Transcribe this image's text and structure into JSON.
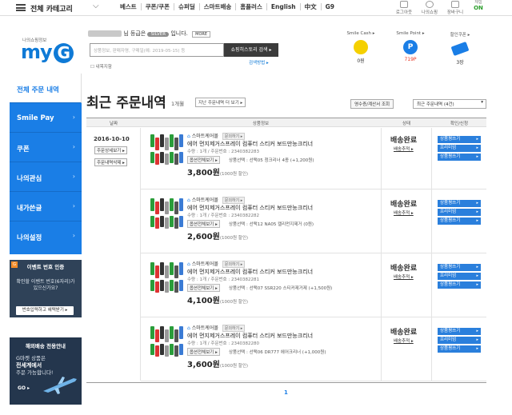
{
  "topbar": {
    "all_category": "전체 카테고리",
    "nav": [
      "베스트",
      "쿠폰/쿠폰",
      "슈퍼딜",
      "스마트배송",
      "홈플러스",
      "English",
      "中文",
      "G9"
    ],
    "icons": [
      {
        "name": "login-icon",
        "label": "로그아웃"
      },
      {
        "name": "mypage-icon",
        "label": "나의쇼핑"
      },
      {
        "name": "cart-icon",
        "label": "장바구니"
      }
    ],
    "toggle": {
      "label": "체험",
      "value": "ON"
    }
  },
  "header": {
    "brand_small": "나의쇼핑정보",
    "brand": "my",
    "brand_g": "G",
    "grade_prefix": "님 등급은",
    "grade": "SILVER",
    "grade_suffix": "입니다.",
    "grade_more": "MORE",
    "search_placeholder": "상품정보, 판매자명, 구매일(예: 2019-05-15) 등",
    "search_button": "쇼핑히스토리 검색 ▸",
    "search_help": "검색방법 ▸",
    "checkbox_label": "☐ 내목지함",
    "smile_cash": {
      "label": "Smile Cash ▸",
      "value": "0원"
    },
    "smile_point": {
      "label": "Smile Point ▸",
      "value": "719P"
    },
    "coupon": {
      "label": "할인쿠폰 ▸",
      "value": "3장"
    },
    "colors": {
      "brand": "#0f7ad6",
      "smile_cash": "#f5d000",
      "smile_point": "#1a7ee6"
    }
  },
  "sidebar": {
    "items": [
      {
        "label": "전체 주문 내역",
        "active": true
      },
      {
        "label": "Smile Pay",
        "active": false
      },
      {
        "label": "쿠폰",
        "active": false
      },
      {
        "label": "나의관심",
        "active": false
      },
      {
        "label": "내가쓴글",
        "active": false
      },
      {
        "label": "나의설정",
        "active": false
      }
    ],
    "event": {
      "badge": "G",
      "title": "이벤트 번호 인증",
      "text": "확인할 이벤트 번호(6자리)가 있으신가요?",
      "button": "번호입력하고 혜택받기 ▸"
    },
    "shipping": {
      "title": "해외배송 전용안내",
      "text1": "G마켓 상품은",
      "text2": "전세계에서",
      "text3": "주문 가능합니다!",
      "go": "GO ▸"
    }
  },
  "main": {
    "title": "최근 주문내역",
    "count": "1개월",
    "more_btn": "지난 주문내역 더 보기 ▸",
    "receipt_btn": "영수증/계산서 조회",
    "period": "최근 주문내역 (4건)",
    "columns": [
      "날짜",
      "상품정보",
      "상태",
      "확인/신청"
    ],
    "order_date": "2016-10-10",
    "order_detail_btn": "주문상세보기 ▸",
    "order_delete_btn": "주문내역삭제 ▸",
    "pagination": "1",
    "rows": [
      {
        "seller": "스마트케어몰",
        "seller_tag": "문의하기 ▸",
        "name": "에어 먼지제거스프레이 컴퓨터 스티커 보드만능크리너",
        "qty": "수량 : 1개 / 주문번호 : 2340382283",
        "option_btn": "옵션전체보기 ▸",
        "option": "상품선택 : 선택05 청크리너 4종 (+1,200원)",
        "price": "3,800원",
        "price_note": "(1000원 할인)",
        "status": "배송완료",
        "delivery_link": "배송추적 ▸",
        "actions": [
          "상품평쓰기",
          "프리미엄",
          "상품평쓰기"
        ]
      },
      {
        "seller": "스마트케어몰",
        "seller_tag": "문의하기 ▸",
        "name": "에어 먼지제거스프레이 컴퓨터 스티커 보드만능크리너",
        "qty": "수량 : 1개 / 주문번호 : 2340382282",
        "option_btn": "옵션전체보기 ▸",
        "option": "상품선택 : 선택12 NA05 캘리먼지제거 (0원)",
        "price": "2,600원",
        "price_note": "(1000원 할인)",
        "status": "배송완료",
        "delivery_link": "배송추적 ▸",
        "actions": [
          "상품평쓰기",
          "프리미엄",
          "상품평쓰기"
        ]
      },
      {
        "seller": "스마트케어몰",
        "seller_tag": "문의하기 ▸",
        "name": "에어 먼지제거스프레이 컴퓨터 스티커 보드만능크리너",
        "qty": "수량 : 1개 / 주문번호 : 2340382281",
        "option_btn": "옵션전체보기 ▸",
        "option": "상품선택 : 선택07 SSR220 스티커제거제 (+1,500원)",
        "price": "4,100원",
        "price_note": "(1000원 할인)",
        "status": "배송완료",
        "delivery_link": "배송추적 ▸",
        "actions": [
          "상품평쓰기",
          "프리미엄",
          "상품평쓰기"
        ]
      },
      {
        "seller": "스마트케어몰",
        "seller_tag": "문의하기 ▸",
        "name": "에어 먼지제거스프레이 컴퓨터 스티커 보드만능크리너",
        "qty": "수량 : 1개 / 주문번호 : 2340382280",
        "option_btn": "옵션전체보기 ▸",
        "option": "상품선택 : 선택06 DR777 에어크리너 (+1,000원)",
        "price": "3,600원",
        "price_note": "(1000원 할인)",
        "status": "배송완료",
        "delivery_link": "배송추적 ▸",
        "actions": [
          "상품평쓰기",
          "프리미엄",
          "상품평쓰기"
        ]
      }
    ]
  }
}
